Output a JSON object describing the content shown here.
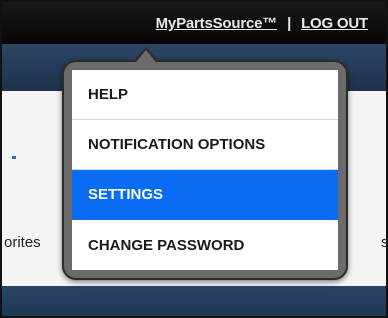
{
  "header": {
    "account_link": "MyPartsSource™",
    "separator": "|",
    "logout_link": "LOG OUT"
  },
  "background": {
    "left_text": "orites",
    "right_text": "s"
  },
  "menu": {
    "items": [
      {
        "label": "HELP",
        "active": false
      },
      {
        "label": "NOTIFICATION OPTIONS",
        "active": false
      },
      {
        "label": "SETTINGS",
        "active": true
      },
      {
        "label": "CHANGE PASSWORD",
        "active": false
      }
    ]
  },
  "colors": {
    "menu_active_bg": "#0a6cf2",
    "menu_border": "#6b6b6b",
    "topbar": "#0a0a0a",
    "navbar": "#233a59"
  }
}
